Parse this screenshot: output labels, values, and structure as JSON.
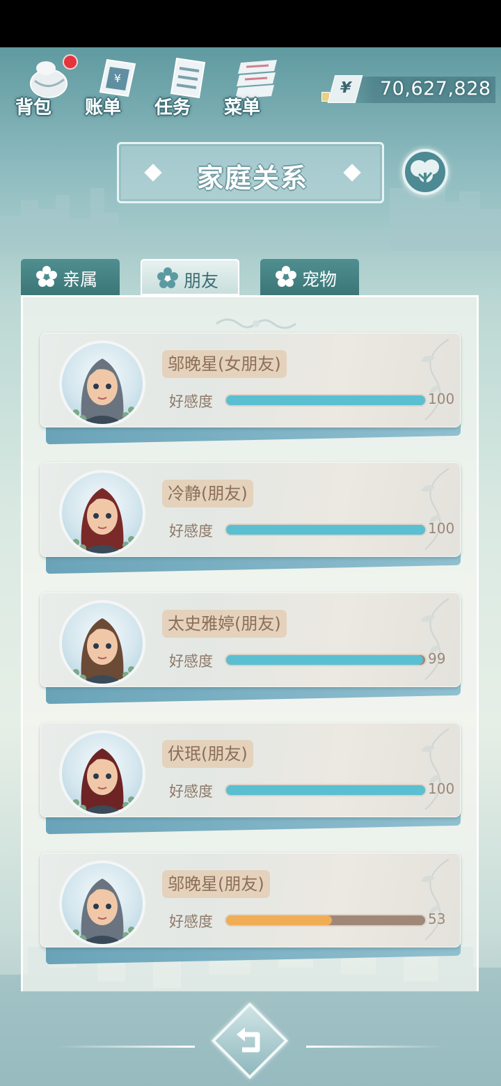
{
  "hud": {
    "buttons": [
      {
        "label": "背包",
        "icon": "bag-icon"
      },
      {
        "label": "账单",
        "icon": "bill-icon"
      },
      {
        "label": "任务",
        "icon": "task-icon"
      },
      {
        "label": "菜单",
        "icon": "menu-icon"
      }
    ],
    "currency_symbol": "¥",
    "money": "70,627,828"
  },
  "title": "家庭关系",
  "tabs": [
    {
      "label": "亲属",
      "active": false
    },
    {
      "label": "朋友",
      "active": true
    },
    {
      "label": "宠物",
      "active": false
    }
  ],
  "favor_label": "好感度",
  "friends": [
    {
      "name": "邬晚星(女朋友)",
      "favor": 100,
      "max": 100,
      "bar_color": "#5bbfd2",
      "hair": "#6a7480"
    },
    {
      "name": "冷静(朋友)",
      "favor": 100,
      "max": 100,
      "bar_color": "#5bbfd2",
      "hair": "#7a2a28"
    },
    {
      "name": "太史雅婷(朋友)",
      "favor": 99,
      "max": 100,
      "bar_color": "#5bbfd2",
      "hair": "#6b4a36"
    },
    {
      "name": "伏珉(朋友)",
      "favor": 100,
      "max": 100,
      "bar_color": "#5bbfd2",
      "hair": "#6e2424"
    },
    {
      "name": "邬晚星(朋友)",
      "favor": 53,
      "max": 100,
      "bar_color": "#f0ad55",
      "hair": "#6a7480"
    }
  ],
  "colors": {
    "accent": "#4f8e8f",
    "favor_high": "#5bbfd2",
    "favor_mid": "#f0ad55",
    "badge": "#e4343c"
  }
}
